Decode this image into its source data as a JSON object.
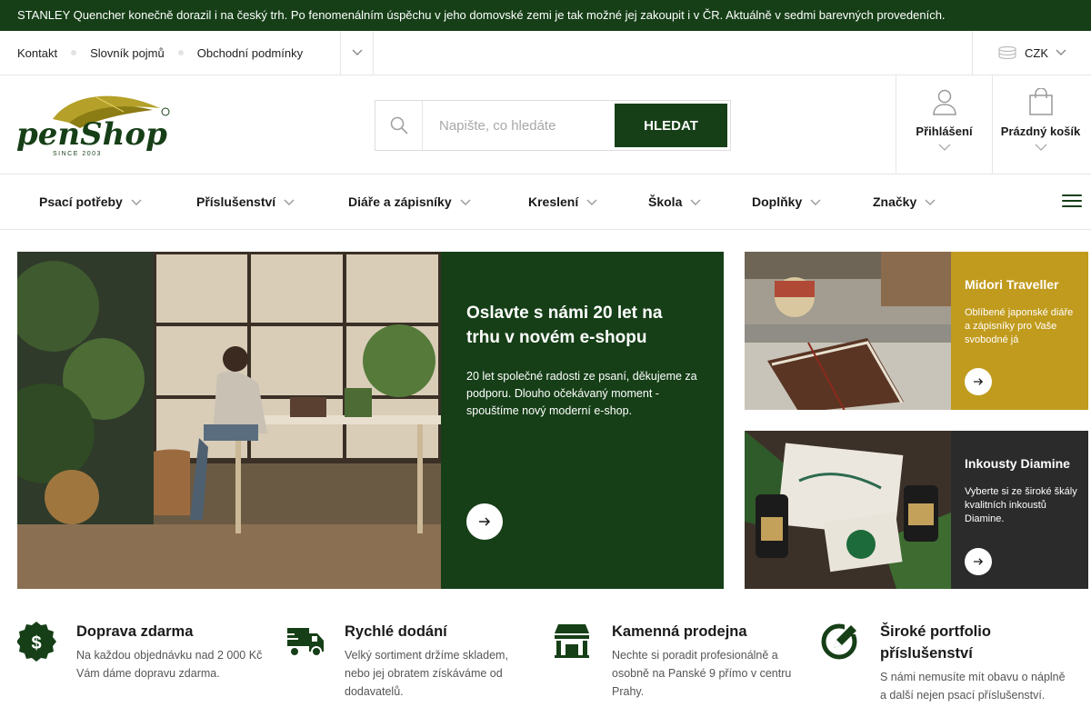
{
  "announcement": "STANLEY Quencher konečně dorazil i na český trh. Po fenomenálním úspěchu v jeho domovské zemi je tak možné jej zakoupit i v ČR. Aktuálně v sedmi barevných provedeních.",
  "util_links": [
    "Kontakt",
    "Slovník pojmů",
    "Obchodní podmínky"
  ],
  "currency": "CZK",
  "logo": {
    "text": "penShop",
    "since": "SINCE 2003"
  },
  "search": {
    "placeholder": "Napište, co hledáte",
    "button": "HLEDAT"
  },
  "account": {
    "login": "Přihlášení",
    "cart": "Prázdný košík"
  },
  "nav": [
    "Psací potřeby",
    "Příslušenství",
    "Diáře a zápisníky",
    "Kreslení",
    "Škola",
    "Doplňky",
    "Značky"
  ],
  "hero": {
    "title": "Oslavte s námi 20 let na trhu v novém e-shopu",
    "text": "20 let společné radosti ze psaní, děkujeme za podporu. Dlouho očekávaný moment - spouštíme nový moderní e-shop."
  },
  "promos": [
    {
      "title": "Midori Traveller",
      "text": "Oblíbené japonské diáře a zápisníky pro Vaše svobodné já",
      "color": "#c19b1d"
    },
    {
      "title": "Inkousty Diamine",
      "text": "Vyberte si ze široké škály kvalitních inkoustů Diamine.",
      "color": "#2b2b2b"
    }
  ],
  "features": [
    {
      "title": "Doprava zdarma",
      "text": "Na každou objednávku nad 2 000 Kč Vám dáme dopravu zdarma.",
      "icon": "money-badge-icon"
    },
    {
      "title": "Rychlé dodání",
      "text": "Velký sortiment držíme skladem, nebo jej obratem získáváme od dodavatelů.",
      "icon": "truck-icon"
    },
    {
      "title": "Kamenná prodejna",
      "text": "Nechte si poradit profesionálně a osobně na Panské 9 přímo v centru Prahy.",
      "icon": "store-icon"
    },
    {
      "title": "Široké portfolio příslušenství",
      "text": "S námi nemusíte mít obavu o náplně a další nejen psací příslušenství.",
      "icon": "pen-circle-icon"
    }
  ],
  "colors": {
    "brand": "#163f17",
    "gold": "#c19b1d",
    "dark": "#2b2b2b"
  }
}
